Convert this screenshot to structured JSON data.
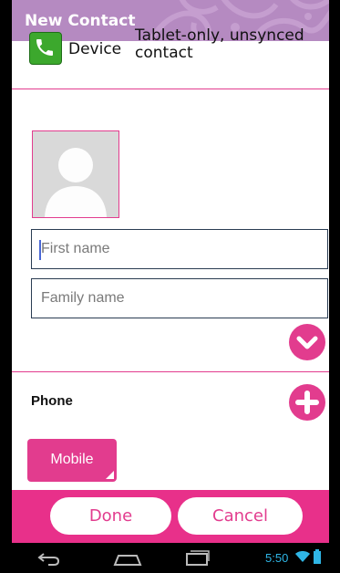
{
  "titlebar": {
    "title": "New Contact"
  },
  "account": {
    "type_label": "Device",
    "description": "Tablet-only, unsynced contact"
  },
  "form": {
    "first_name_placeholder": "First name",
    "first_name_value": "",
    "family_name_placeholder": "Family name",
    "family_name_value": ""
  },
  "phone_section": {
    "heading": "Phone",
    "type_label": "Mobile"
  },
  "actions": {
    "done_label": "Done",
    "cancel_label": "Cancel"
  },
  "statusbar": {
    "time": "5:50"
  },
  "icons": {
    "account": "phone-icon",
    "photo": "contact-silhouette-icon",
    "expand": "chevron-down-icon",
    "add": "plus-icon",
    "nav": [
      "back-icon",
      "home-icon",
      "recent-apps-icon"
    ],
    "status": [
      "wifi-icon",
      "battery-icon"
    ]
  },
  "colors": {
    "accent": "#e23c8e",
    "action_bar": "#e8308a",
    "title_bar": "#b58ac1",
    "clock": "#2fb6e6"
  }
}
